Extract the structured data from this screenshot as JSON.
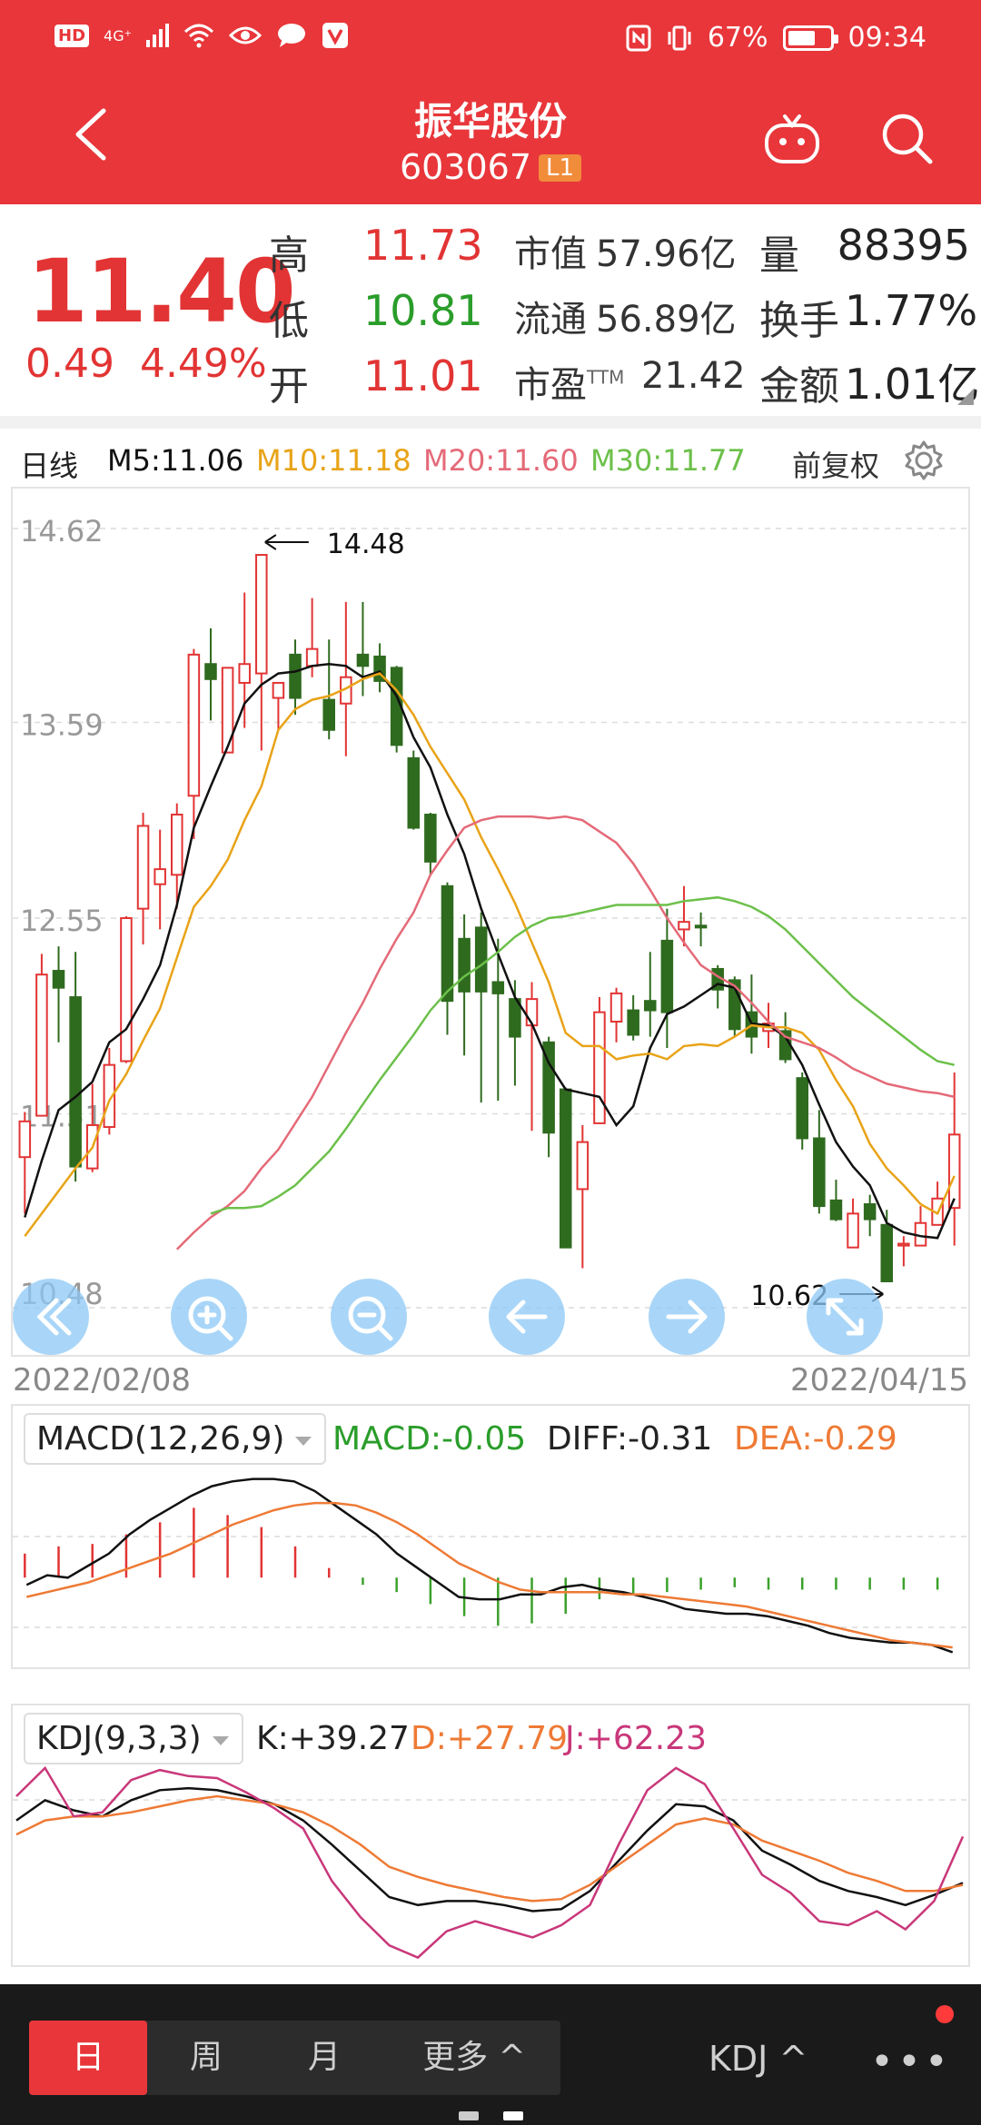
{
  "status": {
    "battery": "67%",
    "battery_level": 0.67,
    "time": "09:34",
    "hd": "HD",
    "net": "4G⁺"
  },
  "header": {
    "title": "振华股份",
    "code": "603067",
    "badge": "L1"
  },
  "quote": {
    "price": "11.40",
    "change": "0.49",
    "change_pct": "4.49%",
    "rows": [
      [
        {
          "label": "高",
          "value": "11.73",
          "color": "red"
        },
        {
          "label": "市值",
          "value": "57.96亿"
        },
        {
          "label": "量",
          "value": "88395"
        }
      ],
      [
        {
          "label": "低",
          "value": "10.81",
          "color": "green"
        },
        {
          "label": "流通",
          "value": "56.89亿"
        },
        {
          "label": "换手",
          "value": "1.77%"
        }
      ],
      [
        {
          "label": "开",
          "value": "11.01",
          "color": "red"
        },
        {
          "label": "市盈",
          "sup": "TTM",
          "value": "21.42"
        },
        {
          "label": "金额",
          "value": "1.01亿"
        }
      ]
    ]
  },
  "ma_row": {
    "period": "日线",
    "m5": "M5:11.06",
    "m10": "M10:11.18",
    "m20": "M20:11.60",
    "m30": "M30:11.77",
    "adjust": "前复权"
  },
  "colors": {
    "up": "#e23434",
    "down": "#2f6b1f",
    "m5": "#111111",
    "m10": "#e8a317",
    "m20": "#e46a78",
    "m30": "#6cc04a",
    "header": "#e8363a"
  },
  "chart_data": [
    {
      "type": "candlestick",
      "title": "",
      "ylim": [
        10.48,
        14.62
      ],
      "y_ticks": [
        "14.62",
        "13.59",
        "12.55",
        "11.51",
        "10.48"
      ],
      "y_tick_values": [
        14.62,
        13.59,
        12.55,
        11.51,
        10.48
      ],
      "x_start": "2022/02/08",
      "x_end": "2022/04/15",
      "max_label": "14.48",
      "min_label": "10.62",
      "candles": [
        [
          11.28,
          11.47,
          11.52,
          10.98
        ],
        [
          11.5,
          12.25,
          12.36,
          11.5
        ],
        [
          12.27,
          12.18,
          12.4,
          11.89
        ],
        [
          12.13,
          11.23,
          12.37,
          11.15
        ],
        [
          11.22,
          11.45,
          11.67,
          11.2
        ],
        [
          11.44,
          11.77,
          11.86,
          11.4
        ],
        [
          11.79,
          12.55,
          12.56,
          11.78
        ],
        [
          12.6,
          13.04,
          13.11,
          12.41
        ],
        [
          12.73,
          12.81,
          13.02,
          12.49
        ],
        [
          12.78,
          13.1,
          13.16,
          12.6
        ],
        [
          13.2,
          13.95,
          13.98,
          12.97
        ],
        [
          13.9,
          13.82,
          14.09,
          13.6
        ],
        [
          13.43,
          13.88,
          13.88,
          13.43
        ],
        [
          13.8,
          13.9,
          14.28,
          13.56
        ],
        [
          13.85,
          14.48,
          14.48,
          13.44
        ],
        [
          13.72,
          13.8,
          13.8,
          13.55
        ],
        [
          13.95,
          13.72,
          14.03,
          13.63
        ],
        [
          13.89,
          13.98,
          14.25,
          13.83
        ],
        [
          13.71,
          13.55,
          14.03,
          13.5
        ],
        [
          13.69,
          13.83,
          14.23,
          13.41
        ],
        [
          13.95,
          13.89,
          14.23,
          13.73
        ],
        [
          13.94,
          13.81,
          14.01,
          13.75
        ],
        [
          13.88,
          13.47,
          13.89,
          13.43
        ],
        [
          13.4,
          13.03,
          13.44,
          13.02
        ],
        [
          13.1,
          12.85,
          13.11,
          12.78
        ],
        [
          12.72,
          12.11,
          12.74,
          11.93
        ],
        [
          12.44,
          12.16,
          12.57,
          11.82
        ],
        [
          12.5,
          12.16,
          12.58,
          11.57
        ],
        [
          12.21,
          12.15,
          12.44,
          11.58
        ],
        [
          12.12,
          11.92,
          12.22,
          11.66
        ],
        [
          11.98,
          12.12,
          12.21,
          11.42
        ],
        [
          11.89,
          11.41,
          11.92,
          11.28
        ],
        [
          11.64,
          10.8,
          11.65,
          10.8
        ],
        [
          11.11,
          11.36,
          11.45,
          10.69
        ],
        [
          11.46,
          12.05,
          12.13,
          11.46
        ],
        [
          12.0,
          12.15,
          12.18,
          11.89
        ],
        [
          12.06,
          11.93,
          12.14,
          11.9
        ],
        [
          12.11,
          12.06,
          12.37,
          11.92
        ],
        [
          12.43,
          12.05,
          12.6,
          11.86
        ],
        [
          12.49,
          12.53,
          12.72,
          12.4
        ],
        [
          12.51,
          12.5,
          12.58,
          12.4
        ],
        [
          12.28,
          12.17,
          12.3,
          12.07
        ],
        [
          12.22,
          11.96,
          12.24,
          11.92
        ],
        [
          12.05,
          11.92,
          12.25,
          11.83
        ],
        [
          11.95,
          11.99,
          12.1,
          11.86
        ],
        [
          11.95,
          11.8,
          12.05,
          11.78
        ],
        [
          11.7,
          11.38,
          11.73,
          11.32
        ],
        [
          11.38,
          11.02,
          11.53,
          10.98
        ],
        [
          11.05,
          10.95,
          11.16,
          10.94
        ],
        [
          10.8,
          10.98,
          11.06,
          10.89
        ],
        [
          11.03,
          10.95,
          11.08,
          10.86
        ],
        [
          10.92,
          10.62,
          11.0,
          10.62
        ],
        [
          10.81,
          10.82,
          10.86,
          10.7
        ],
        [
          10.81,
          10.93,
          11.02,
          10.81
        ],
        [
          10.92,
          11.06,
          11.15,
          10.92
        ],
        [
          11.01,
          11.4,
          11.73,
          10.81
        ]
      ],
      "series": [
        {
          "name": "M5",
          "values": [
            10.96,
            11.26,
            11.53,
            11.6,
            11.68,
            11.89,
            11.96,
            12.12,
            12.3,
            12.62,
            13.03,
            13.25,
            13.46,
            13.69,
            13.79,
            13.85,
            13.86,
            13.89,
            13.9,
            13.89,
            13.83,
            13.86,
            13.73,
            13.51,
            13.35,
            13.1,
            12.89,
            12.6,
            12.36,
            12.13,
            11.99,
            11.78,
            11.64,
            11.62,
            11.6,
            11.45,
            11.55,
            11.86,
            12.04,
            12.08,
            12.14,
            12.2,
            12.18,
            11.99,
            11.98,
            11.92,
            11.77,
            11.56,
            11.36,
            11.23,
            11.13,
            10.93,
            10.88,
            10.86,
            10.85,
            11.06
          ]
        },
        {
          "name": "M10",
          "values": [
            10.86,
            10.98,
            11.1,
            11.22,
            11.33,
            11.58,
            11.72,
            11.9,
            12.07,
            12.34,
            12.61,
            12.72,
            12.86,
            13.07,
            13.25,
            13.55,
            13.66,
            13.71,
            13.73,
            13.77,
            13.82,
            13.85,
            13.76,
            13.63,
            13.46,
            13.32,
            13.18,
            12.98,
            12.81,
            12.63,
            12.42,
            12.21,
            11.94,
            11.87,
            11.87,
            11.8,
            11.82,
            11.83,
            11.8,
            11.87,
            11.88,
            11.87,
            11.92,
            11.98,
            11.97,
            11.97,
            11.94,
            11.85,
            11.69,
            11.55,
            11.35,
            11.22,
            11.13,
            11.03,
            10.98,
            11.18
          ]
        },
        {
          "name": "M20",
          "values": [
            10.79,
            10.88,
            10.96,
            11.02,
            11.1,
            11.22,
            11.32,
            11.46,
            11.6,
            11.77,
            11.94,
            12.1,
            12.28,
            12.44,
            12.58,
            12.78,
            12.91,
            13.03,
            13.07,
            13.09,
            13.09,
            13.09,
            13.08,
            13.09,
            13.07,
            13.01,
            12.95,
            12.84,
            12.7,
            12.55,
            12.42,
            12.3,
            12.24,
            12.19,
            12.1,
            12.0,
            11.92,
            11.89,
            11.86,
            11.81,
            11.75,
            11.71,
            11.67,
            11.65,
            11.63,
            11.62,
            11.6
          ]
        },
        {
          "name": "M30",
          "values": [
            10.98,
            11.01,
            11.01,
            11.02,
            11.07,
            11.13,
            11.22,
            11.31,
            11.43,
            11.56,
            11.69,
            11.81,
            11.93,
            12.06,
            12.16,
            12.24,
            12.3,
            12.37,
            12.45,
            12.51,
            12.55,
            12.56,
            12.58,
            12.6,
            12.62,
            12.62,
            12.62,
            12.62,
            12.64,
            12.65,
            12.66,
            12.64,
            12.61,
            12.56,
            12.49,
            12.4,
            12.31,
            12.22,
            12.13,
            12.06,
            11.99,
            11.92,
            11.85,
            11.79,
            11.77
          ]
        }
      ]
    },
    {
      "type": "bar+line",
      "title": "MACD",
      "selector": "MACD(12,26,9)",
      "macd_label": "MACD:-0.05",
      "diff_label": "DIFF:-0.31",
      "dea_label": "DEA:-0.29",
      "ylim": [
        -0.35,
        0.45
      ],
      "histogram": [
        0.1,
        0.11,
        0.13,
        0.1,
        0.14,
        0.16,
        0.18,
        0.22,
        0.23,
        0.26,
        0.29,
        0.27,
        0.26,
        0.24,
        0.21,
        0.17,
        0.13,
        0.08,
        0.04,
        0.0,
        -0.03,
        -0.05,
        -0.06,
        -0.09,
        -0.11,
        -0.13,
        -0.16,
        -0.19,
        -0.2,
        -0.2,
        -0.19,
        -0.17,
        -0.15,
        -0.12,
        -0.09,
        -0.08,
        -0.07,
        -0.06,
        -0.06,
        -0.05,
        -0.05,
        -0.04,
        -0.04,
        -0.04,
        -0.05,
        -0.05,
        -0.05,
        -0.05,
        -0.05,
        -0.05,
        -0.05,
        -0.05,
        -0.05,
        -0.05,
        -0.05,
        -0.05
      ],
      "series": [
        {
          "name": "DIFF",
          "values": [
            -0.03,
            0.01,
            0.0,
            0.05,
            0.1,
            0.18,
            0.24,
            0.29,
            0.34,
            0.38,
            0.4,
            0.41,
            0.41,
            0.4,
            0.36,
            0.3,
            0.24,
            0.18,
            0.1,
            0.04,
            -0.02,
            -0.08,
            -0.09,
            -0.09,
            -0.07,
            -0.07,
            -0.04,
            -0.03,
            -0.05,
            -0.06,
            -0.08,
            -0.1,
            -0.13,
            -0.14,
            -0.15,
            -0.15,
            -0.16,
            -0.18,
            -0.2,
            -0.23,
            -0.25,
            -0.26,
            -0.27,
            -0.27,
            -0.28,
            -0.31
          ]
        },
        {
          "name": "DEA",
          "values": [
            -0.08,
            -0.06,
            -0.04,
            -0.02,
            0.01,
            0.04,
            0.07,
            0.1,
            0.14,
            0.18,
            0.22,
            0.25,
            0.28,
            0.3,
            0.31,
            0.31,
            0.3,
            0.27,
            0.23,
            0.18,
            0.12,
            0.06,
            0.02,
            -0.02,
            -0.05,
            -0.06,
            -0.06,
            -0.06,
            -0.06,
            -0.07,
            -0.07,
            -0.08,
            -0.09,
            -0.1,
            -0.11,
            -0.12,
            -0.14,
            -0.16,
            -0.18,
            -0.2,
            -0.22,
            -0.24,
            -0.26,
            -0.27,
            -0.28,
            -0.29
          ]
        }
      ]
    },
    {
      "type": "line",
      "title": "KDJ",
      "selector": "KDJ(9,3,3)",
      "k_label": "K:+39.27",
      "d_label": "D:+27.79",
      "j_label": "J:+62.23",
      "ylim": [
        0,
        100
      ],
      "series": [
        {
          "name": "K",
          "values": [
            70,
            80,
            75,
            72,
            80,
            85,
            86,
            85,
            82,
            78,
            70,
            58,
            45,
            32,
            28,
            30,
            30,
            28,
            25,
            26,
            35,
            50,
            65,
            78,
            77,
            70,
            55,
            48,
            40,
            35,
            32,
            28,
            33,
            39
          ]
        },
        {
          "name": "D",
          "values": [
            63,
            70,
            72,
            72,
            74,
            77,
            80,
            82,
            80,
            78,
            74,
            67,
            58,
            47,
            42,
            38,
            35,
            32,
            30,
            31,
            38,
            48,
            58,
            68,
            71,
            68,
            60,
            55,
            50,
            44,
            40,
            35,
            35,
            38
          ]
        },
        {
          "name": "J",
          "values": [
            82,
            96,
            72,
            74,
            90,
            95,
            92,
            91,
            84,
            76,
            66,
            40,
            22,
            8,
            2,
            15,
            20,
            16,
            12,
            18,
            28,
            58,
            85,
            96,
            88,
            66,
            43,
            34,
            20,
            18,
            25,
            16,
            30,
            62
          ]
        }
      ]
    }
  ],
  "bottom": {
    "tabs": [
      "日",
      "周",
      "月",
      "更多 ^"
    ],
    "indicator": "KDJ ^",
    "more": "•••"
  }
}
